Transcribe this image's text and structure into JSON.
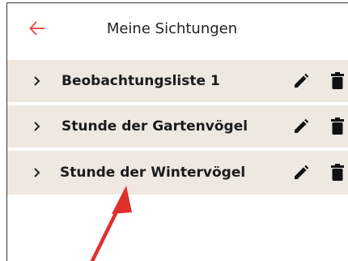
{
  "header": {
    "title": "Meine Sichtungen",
    "back_icon": "arrow-left-icon",
    "accent_color": "#e8534b"
  },
  "lists": [
    {
      "label": "Beobachtungsliste 1"
    },
    {
      "label": "Stunde der Gartenvögel"
    },
    {
      "label": "Stunde der Wintervögel"
    }
  ],
  "icons": {
    "expand": "chevron-right-icon",
    "edit": "pencil-icon",
    "delete": "trash-icon"
  },
  "annotation": {
    "type": "red-arrow",
    "color": "#e0302c",
    "points_to": "Stunde der Wintervögel"
  },
  "colors": {
    "row_background": "#efe8e1",
    "text": "#1b1b1b"
  }
}
